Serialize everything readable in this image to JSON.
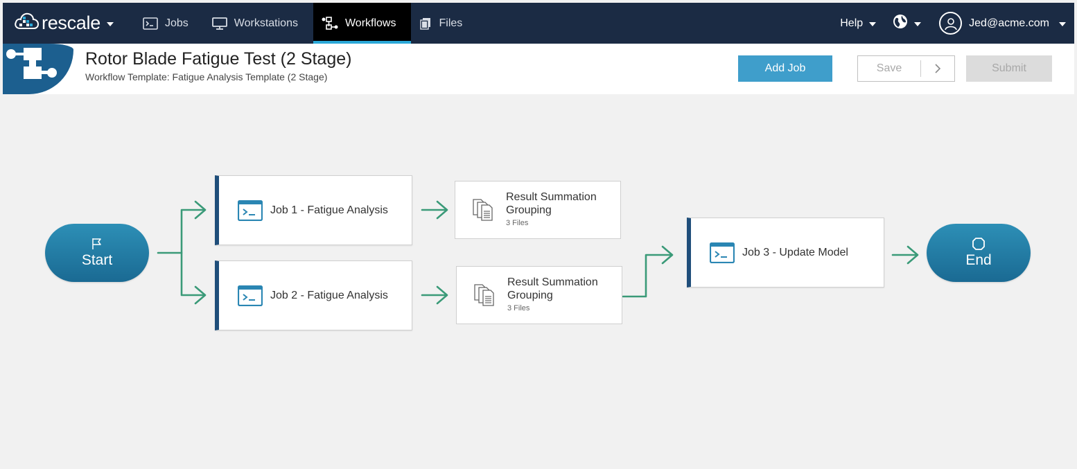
{
  "nav": {
    "brand": "rescale",
    "items": [
      {
        "label": "Jobs",
        "icon": "terminal-icon"
      },
      {
        "label": "Workstations",
        "icon": "monitor-icon"
      },
      {
        "label": "Workflows",
        "icon": "workflow-icon",
        "active": true
      },
      {
        "label": "Files",
        "icon": "files-icon"
      }
    ],
    "help": "Help",
    "user": "Jed@acme.com"
  },
  "header": {
    "title": "Rotor Blade Fatigue Test (2 Stage)",
    "subtitle": "Workflow Template: Fatigue Analysis Template (2 Stage)",
    "add_job": "Add Job",
    "save": "Save",
    "submit": "Submit"
  },
  "workflow": {
    "start": "Start",
    "end": "End",
    "jobs": [
      {
        "label": "Job 1 - Fatigue Analysis"
      },
      {
        "label": "Job 2 - Fatigue Analysis"
      },
      {
        "label": "Job 3 - Update Model"
      }
    ],
    "groups": [
      {
        "title": "Result Summation Grouping",
        "count": "3 Files"
      },
      {
        "title": "Result Summation Grouping",
        "count": "3 Files"
      }
    ]
  },
  "colors": {
    "nav_bg": "#1b2b44",
    "active_underline": "#2aa8d8",
    "accent": "#3f9ecb",
    "connector": "#3a9a78",
    "job_border": "#1f4e7a"
  }
}
